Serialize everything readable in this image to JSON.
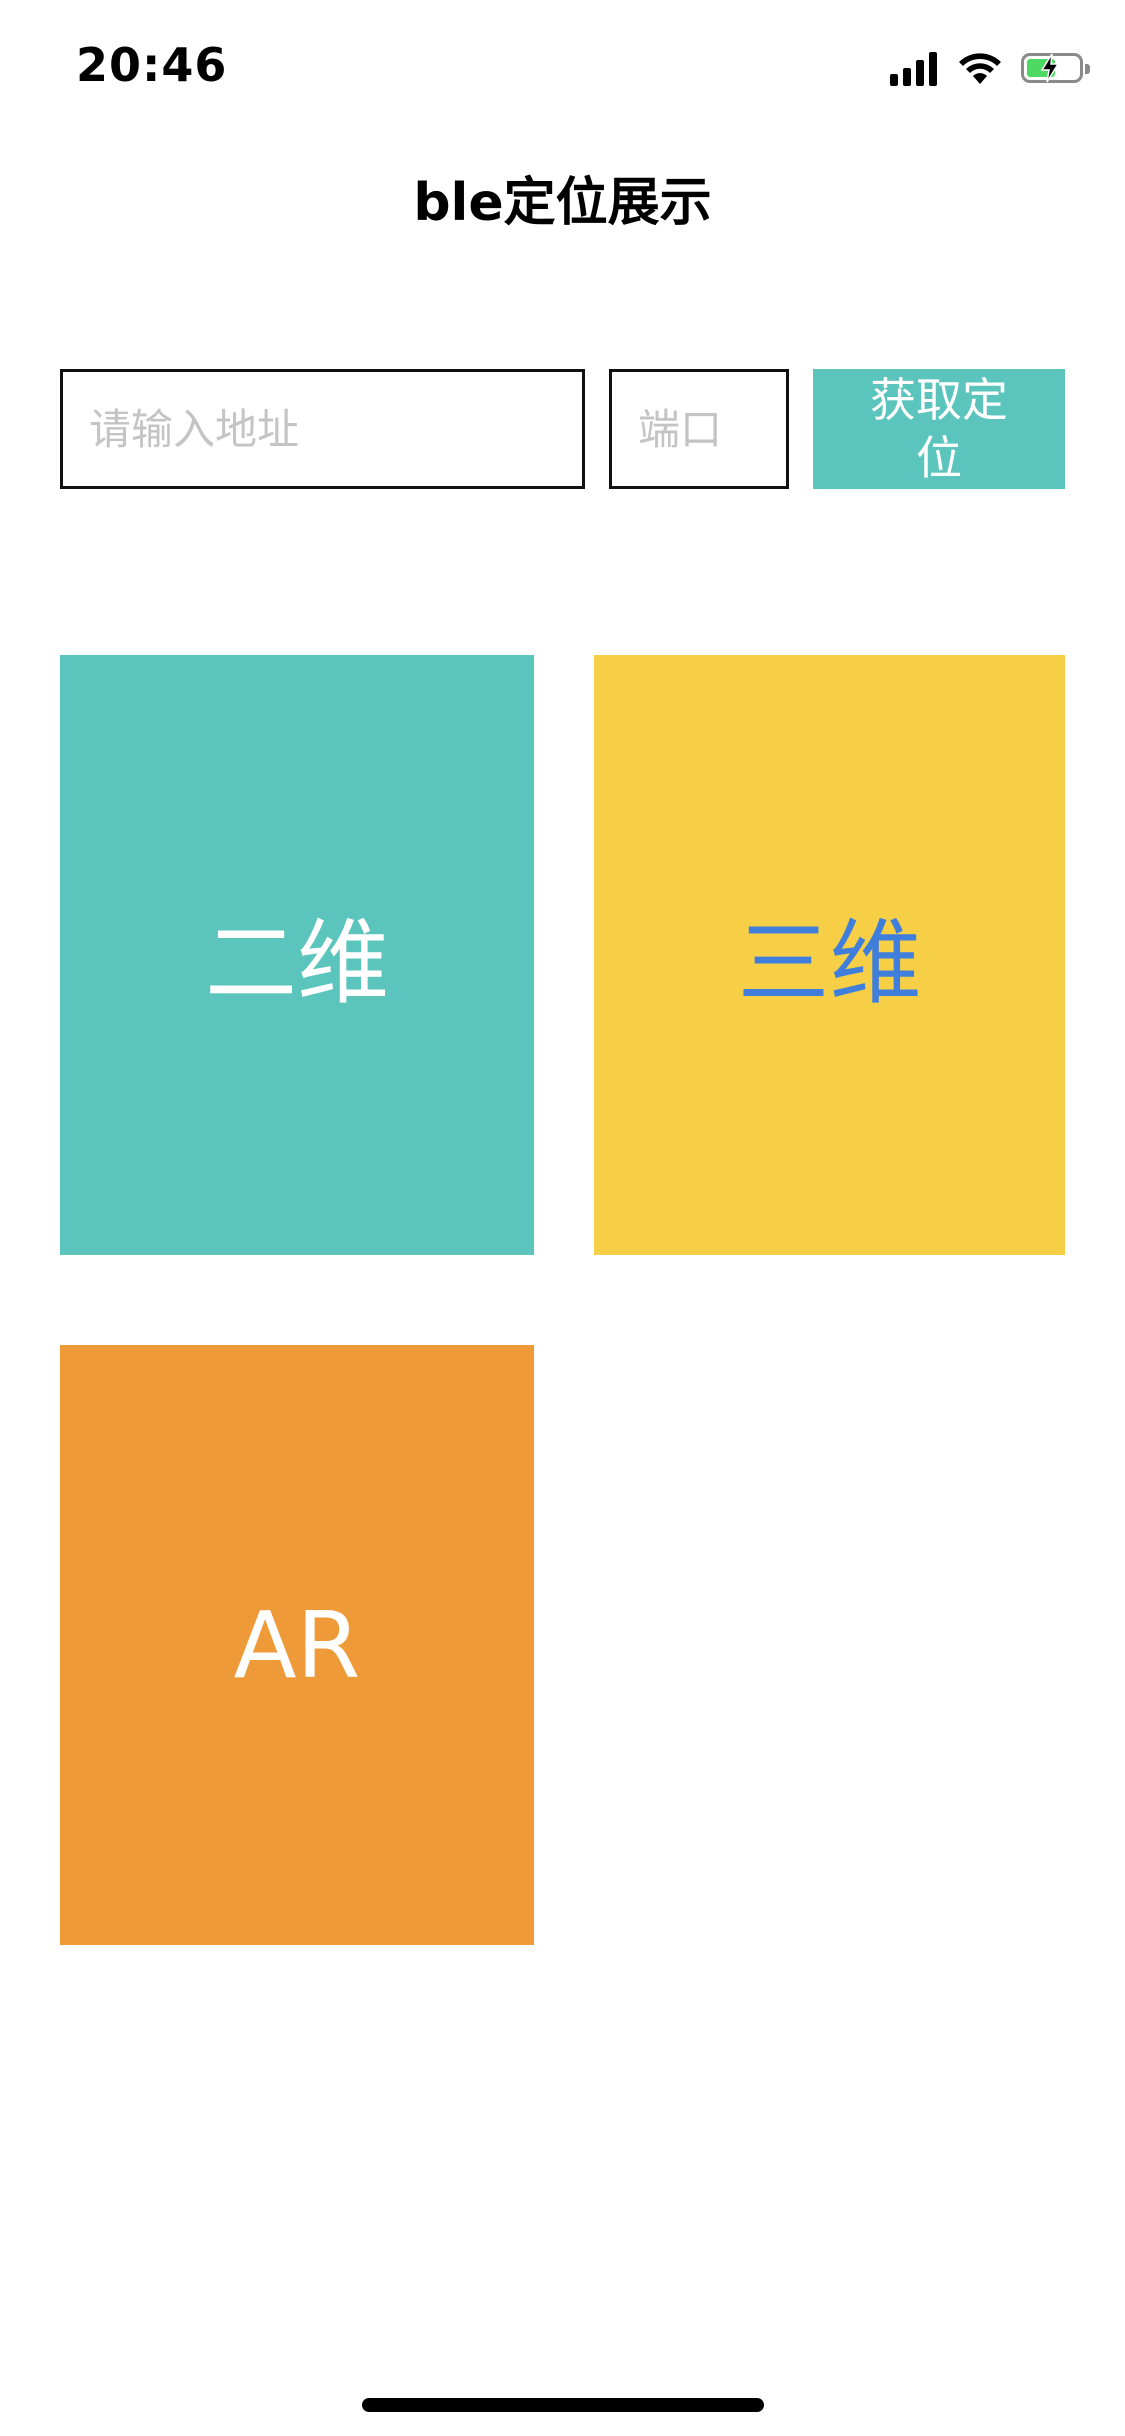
{
  "status_bar": {
    "time": "20:46",
    "icons": [
      "signal-icon",
      "wifi-icon",
      "battery-charging-icon"
    ]
  },
  "nav": {
    "title": "ble定位展示"
  },
  "form": {
    "address_placeholder": "请输入地址",
    "address_value": "",
    "port_placeholder": "端口",
    "port_value": "",
    "get_location_label": "获取定位"
  },
  "tiles": [
    {
      "label": "二维",
      "bg": "#5bc5bd",
      "color": "#ffffff"
    },
    {
      "label": "三维",
      "bg": "#f6cf47",
      "color": "#3f7fdb"
    },
    {
      "label": "AR",
      "bg": "#ef9a38",
      "color": "#ffffff"
    }
  ],
  "colors": {
    "accent": "#5bc5bd",
    "battery": "#4cd964"
  }
}
